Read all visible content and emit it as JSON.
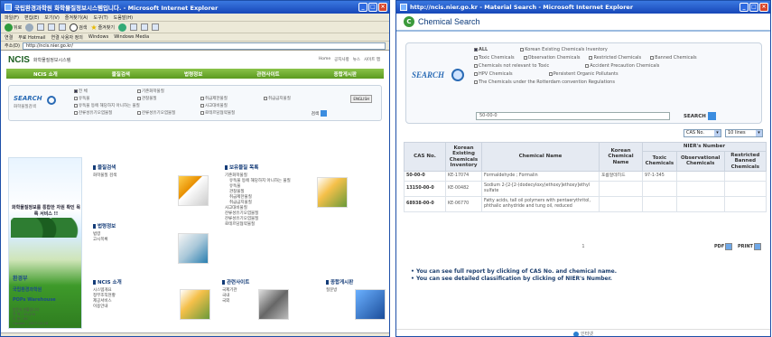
{
  "left_window": {
    "title": "국립환경과학원 화학물질정보시스템입니다. - Microsoft Internet Explorer",
    "menu": [
      "파일(F)",
      "편집(E)",
      "보기(V)",
      "즐겨찾기(A)",
      "도구(T)",
      "도움말(H)"
    ],
    "toolbar": {
      "back": "뒤로",
      "search": "검색",
      "favorites": "즐겨찾기"
    },
    "links_bar": [
      "연결",
      "무료 Hotmail",
      "연결 사용자 정의",
      "Windows",
      "Windows Media"
    ],
    "address_label": "주소(D)",
    "address": "http://ncis.nier.go.kr/",
    "site": {
      "logo": "NCIS",
      "logo_sub": "화학물질정보시스템",
      "top_links": [
        "Home",
        "공지사항",
        "뉴스",
        "사이트 맵"
      ],
      "nav": [
        "NCIS 소개",
        "물질검색",
        "법령정보",
        "관련사이트",
        "종합게시판"
      ],
      "search_title": "SEARCH",
      "search_sub": "화학물질검색",
      "search_options": [
        "전 체",
        "기존화학물질",
        "",
        "",
        "유독물",
        "관찰물질",
        "취급제한물질",
        "취급금지물질",
        "유독물 등에 해당하지 아니하는 물질",
        "사고대비물질",
        "",
        "",
        "잔류성유기오염물질",
        "잔류성유기오염물질",
        "로테르담협약물질",
        ""
      ],
      "search_reset": "ENGLISH",
      "search_go": "검색",
      "hero_text": "화학물질정보를 통합한 자원 확인 목록 서비스 !!",
      "hero_logo_1": "환경부",
      "hero_logo_2": "국립환경과학원",
      "hero_logo_3": "POPs Warehouse",
      "hero_addr": [
        "방문자 현황입니다",
        "전 체 : 10,434",
        "오 늘 : 95",
        "Update : 2007.02.28"
      ],
      "sections": {
        "s1": {
          "title": "물질검색",
          "items": [
            "화학물질 검색"
          ]
        },
        "s2": {
          "title": "보유물질 목록",
          "items": [
            "기존화학물질",
            "유독물 등에 해당하지 아니하는 물질",
            "유독물",
            "관찰물질",
            "취급제한물질",
            "취급금지물질",
            "사고대비물질",
            "잔류성유기오염물질",
            "잔류성유기오염물질",
            "로테르담협약물질"
          ]
        },
        "s3": {
          "title": "법령정보",
          "items": [
            "법령",
            "고시목록"
          ]
        },
        "s4": {
          "title": "NCIS 소개",
          "items": [
            "시스템개요",
            "정부조직현황",
            "제공서비스",
            "이용안내"
          ]
        },
        "s5": {
          "title": "관련사이트",
          "items": [
            "국제기관",
            "국내",
            "국외"
          ]
        },
        "s6": {
          "title": "종합게시판",
          "items": [
            "질문방"
          ]
        }
      }
    }
  },
  "right_window": {
    "title": "http://ncis.nier.go.kr - Material Search - Microsoft Internet Explorer",
    "page_title": "Chemical Search",
    "search_title": "SEARCH",
    "options": {
      "row1": [
        "ALL",
        "Korean Existing Chemicals Inventory"
      ],
      "row2": [
        "Toxic Chemicals",
        "Observation Chemicals",
        "Restricted Chemicals",
        "Banned Chemicals"
      ],
      "row3": [
        "Chemicals not relevant to Toxic",
        "Accident Precaution Chemicals"
      ],
      "row4": [
        "HPV Chemicals",
        "Persistent Organic Pollutants"
      ],
      "row5": [
        "The Chemicals under the Rotterdam convention Regulations"
      ]
    },
    "search_value": "50-00-0",
    "search_button": "SEARCH",
    "sort_select": "CAS No.",
    "lines_select": "10 lines",
    "table": {
      "headers": [
        "CAS No.",
        "Korean Existing Chemicals Inventory",
        "Chemical Name",
        "Korean Chemical Name",
        "NIER's Number"
      ],
      "sub_headers": [
        "Toxic Chemicals",
        "Observational Chemicals",
        "Restricted Banned Chemicals"
      ],
      "rows": [
        {
          "cas": "50-00-0",
          "kec": "KE-17074",
          "name": "Formaldehyde ; Formalin",
          "kname": "포름알데히드",
          "toxic": "97-1-345",
          "obs": "",
          "res": ""
        },
        {
          "cas": "13150-00-0",
          "kec": "KE-00482",
          "name": "Sodium 2-[2-[2-(dodecyloxy)ethoxy]ethoxy]ethyl sulfate",
          "kname": "",
          "toxic": "",
          "obs": "",
          "res": ""
        },
        {
          "cas": "68938-00-0",
          "kec": "KE-06770",
          "name": "Fatty acids, tall oil polymers with pentaerythritol, phthalic anhydride and tung oil, reduced",
          "kname": "",
          "toxic": "",
          "obs": "",
          "res": ""
        }
      ]
    },
    "page_number": "1",
    "pdf": "PDF",
    "print": "PRINT",
    "notes": [
      "You can see full report by clicking of CAS No. and chemical name.",
      "You can see detailed classification by clicking of NIER's Number."
    ],
    "footer": "인터넷"
  }
}
